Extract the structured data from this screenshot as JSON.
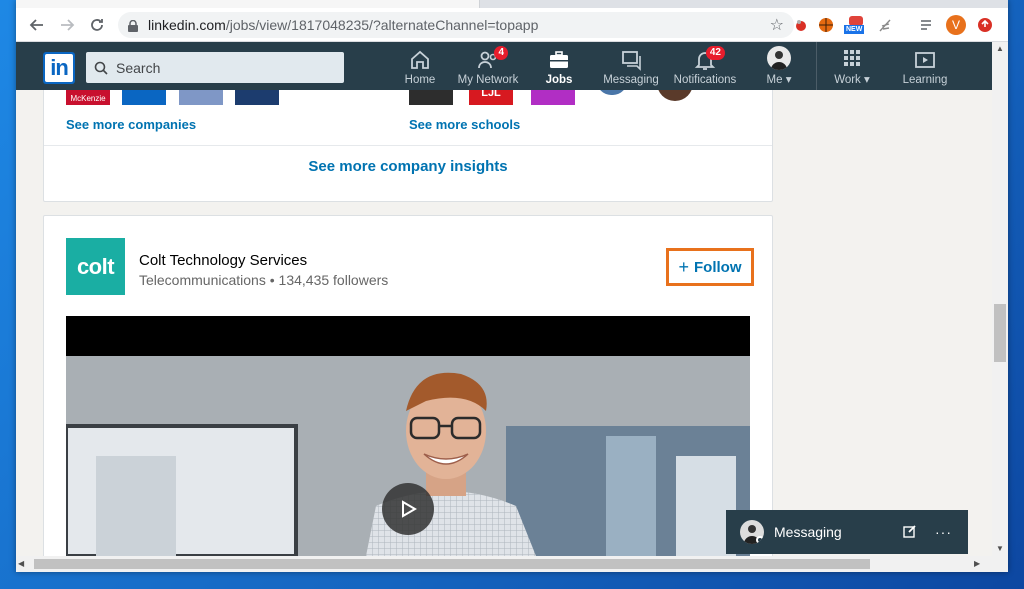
{
  "browser": {
    "url_host": "linkedin.com",
    "url_rest": "/jobs/view/1817048235/?alternateChannel=topapp",
    "profile_initial": "V",
    "ext_new_label": "NEW"
  },
  "nav": {
    "search_placeholder": "Search",
    "items": [
      {
        "label": "Home",
        "icon": "home-icon"
      },
      {
        "label": "My Network",
        "icon": "network-icon",
        "badge": "4"
      },
      {
        "label": "Jobs",
        "icon": "jobs-icon"
      },
      {
        "label": "Messaging",
        "icon": "messaging-icon"
      },
      {
        "label": "Notifications",
        "icon": "bell-icon",
        "badge": "42"
      },
      {
        "label": "Me",
        "icon": "avatar"
      },
      {
        "label": "Work",
        "icon": "grid-icon"
      },
      {
        "label": "Learning",
        "icon": "learning-icon"
      }
    ]
  },
  "card_companies": {
    "see_more_companies": "See more companies",
    "see_more_schools": "See more schools",
    "company_logo_text": "McKenzie",
    "school_logo_text": "LJL",
    "insights": "See more company insights"
  },
  "company": {
    "logo_text": "colt",
    "name": "Colt Technology Services",
    "industry": "Telecommunications",
    "followers": "134,435 followers",
    "separator": " • ",
    "follow_label": "Follow",
    "follow_plus": "+"
  },
  "messaging": {
    "label": "Messaging"
  },
  "colors": {
    "nav_bg": "#283e4a",
    "link_blue": "#0073b1",
    "colt_teal": "#1aaea3",
    "highlight_orange": "#e8711c",
    "badge_red": "#e81d2c"
  }
}
